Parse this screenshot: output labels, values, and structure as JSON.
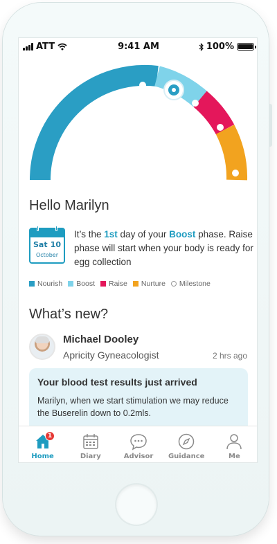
{
  "status": {
    "carrier": "ATT",
    "time": "9:41 AM",
    "battery": "100%"
  },
  "cycle": {
    "current_phase": "Boost",
    "colors": {
      "nourish": "#2a9ec4",
      "boost": "#7fd3ea",
      "raise": "#e4175b",
      "nurture": "#f2a31f"
    }
  },
  "greeting": "Hello Marilyn",
  "calendar": {
    "weekday": "Sat",
    "day": "10",
    "month": "October"
  },
  "phase_text": {
    "prefix": "It’s the ",
    "ordinal": "1st",
    "middle": " day of your ",
    "phase": "Boost",
    "suffix": " phase. Raise phase will start when your body is ready for egg collection"
  },
  "legend": [
    {
      "label": "Nourish",
      "color": "#2a9ec4"
    },
    {
      "label": "Boost",
      "color": "#7fd3ea"
    },
    {
      "label": "Raise",
      "color": "#e4175b"
    },
    {
      "label": "Nurture",
      "color": "#f2a31f"
    },
    {
      "label": "Milestone",
      "color": "#ffffff"
    }
  ],
  "whats_new": {
    "title": "What’s new?",
    "doctor_name": "Michael Dooley",
    "doctor_role": "Apricity Gyneacologist",
    "time_ago": "2 hrs ago",
    "card_title": "Your blood test results just arrived",
    "card_body": "Marilyn, when we start stimulation we may reduce the Buserelin down to 0.2mls."
  },
  "tabs": [
    {
      "label": "Home",
      "icon": "home-icon",
      "active": true,
      "badge": "1"
    },
    {
      "label": "Diary",
      "icon": "calendar-icon"
    },
    {
      "label": "Advisor",
      "icon": "chat-icon"
    },
    {
      "label": "Guidance",
      "icon": "compass-icon"
    },
    {
      "label": "Me",
      "icon": "person-icon"
    }
  ]
}
